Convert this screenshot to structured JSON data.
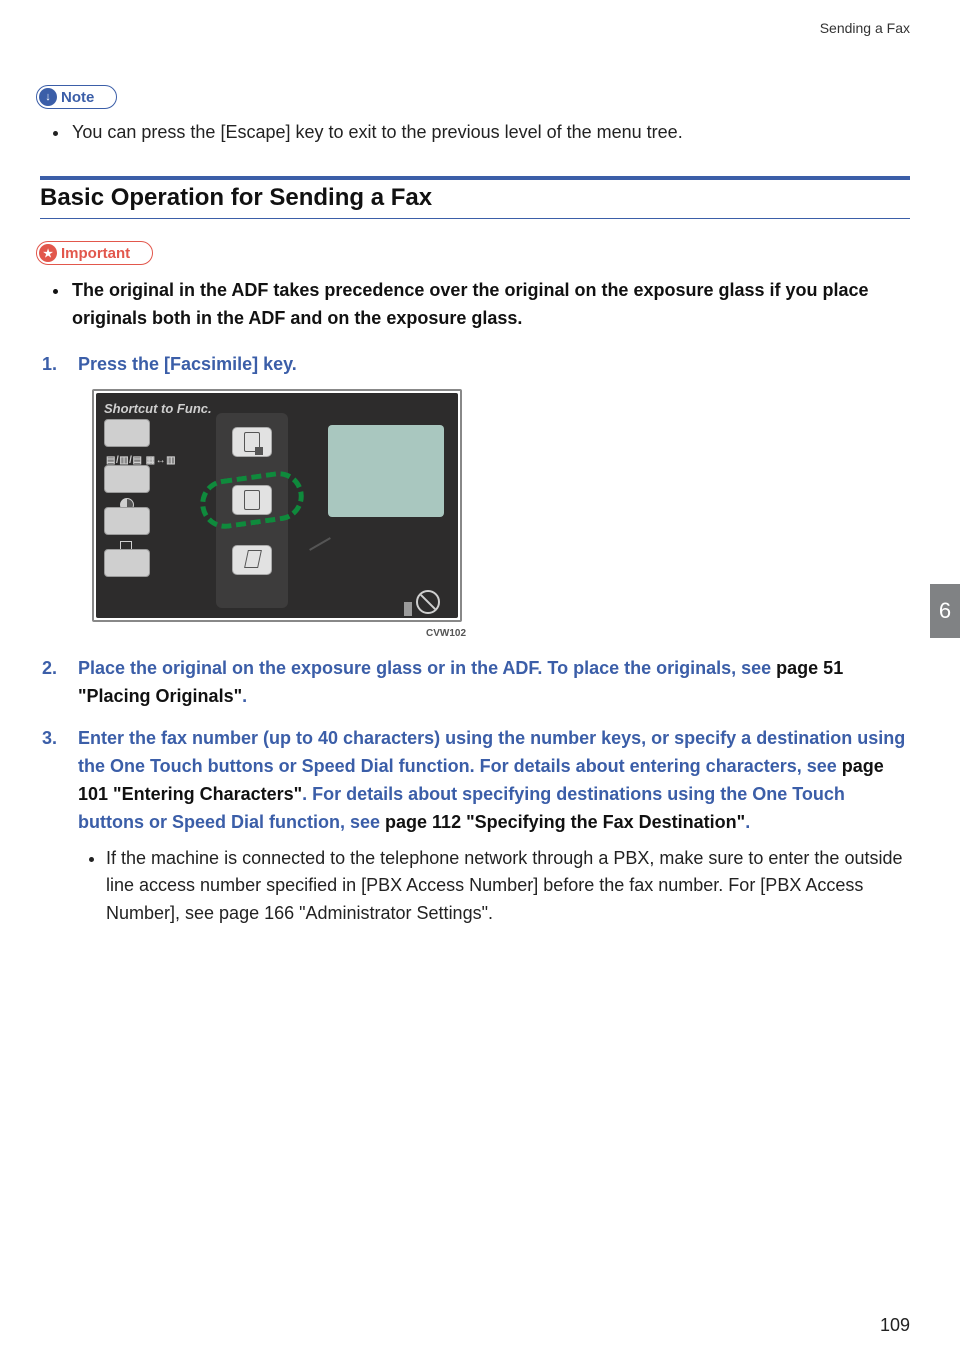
{
  "header": {
    "running_head": "Sending a Fax"
  },
  "note": {
    "label": "Note",
    "items": [
      "You can press the [Escape] key to exit to the previous level of the menu tree."
    ]
  },
  "section": {
    "title": "Basic Operation for Sending a Fax"
  },
  "important": {
    "label": "Important",
    "items": [
      "The original in the ADF takes precedence over the original on the exposure glass if you place originals both in the ADF and on the exposure glass."
    ]
  },
  "steps": {
    "s1": "Press the [Facsimile] key.",
    "figure": {
      "panel_label": "Shortcut to Func.",
      "caption": "CVW102"
    },
    "s2a": "Place the original on the exposure glass or in the ADF. To place the originals, see ",
    "s2b": "page 51 \"Placing Originals\"",
    "s2c": ".",
    "s3a": "Enter the fax number (up to 40 characters) using the number keys, or specify a destination using the One Touch buttons or Speed Dial function. For details about entering characters, see ",
    "s3b": "page 101 \"Entering Characters\"",
    "s3c": ". For details about specifying destinations using the One Touch buttons or Speed Dial function, see ",
    "s3d": "page 112 \"Specifying the Fax Destination\"",
    "s3e": ".",
    "s3_sub": "If the machine is connected to the telephone network through a PBX, make sure to enter the outside line access number specified in [PBX Access Number] before the fax number. For [PBX Access Number], see page 166 \"Administrator Settings\"."
  },
  "chapter_tab": "6",
  "page_number": "109"
}
